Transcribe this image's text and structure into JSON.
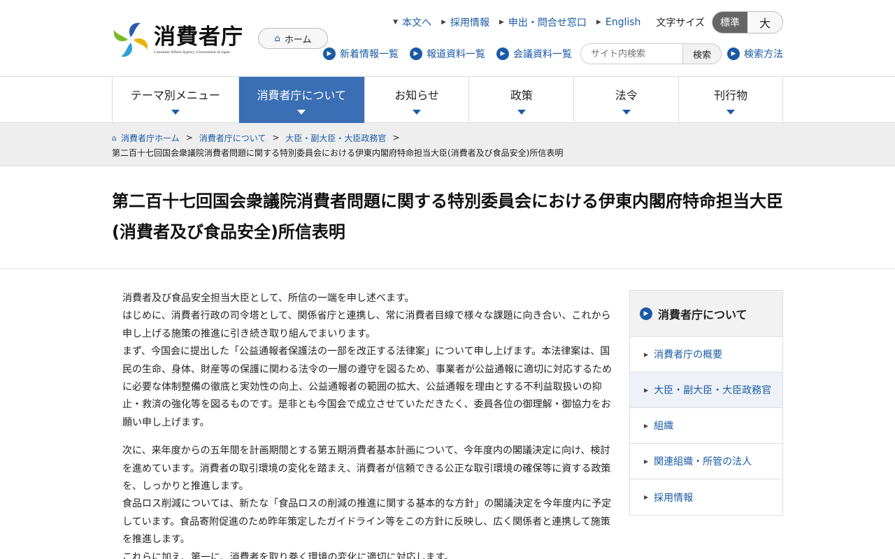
{
  "logo": {
    "title": "消費者庁",
    "subtitle": "Consumer Affairs Agency, Government of Japan"
  },
  "home_button": "ホーム",
  "top_links": [
    "本文へ",
    "採用情報",
    "申出・問合せ窓口",
    "English"
  ],
  "font_size": {
    "label": "文字サイズ",
    "standard": "標準",
    "large": "大"
  },
  "sub_links": [
    "新着情報一覧",
    "報道資料一覧",
    "会議資料一覧"
  ],
  "search": {
    "placeholder": "サイト内検索",
    "button": "検索",
    "howto": "検索方法"
  },
  "nav": [
    "テーマ別メニュー",
    "消費者庁について",
    "お知らせ",
    "政策",
    "法令",
    "刊行物"
  ],
  "breadcrumb": {
    "items": [
      "消費者庁ホーム",
      "消費者庁について",
      "大臣・副大臣・大臣政務官"
    ],
    "current": "第二百十七回国会衆議院消費者問題に関する特別委員会における伊東内閣府特命担当大臣(消費者及び食品安全)所信表明"
  },
  "page_title": "第二百十七回国会衆議院消費者問題に関する特別委員会における伊東内閣府特命担当大臣(消費者及び食品安全)所信表明",
  "article": {
    "p1": "消費者及び食品安全担当大臣として、所信の一端を申し述べます。",
    "p2": "はじめに、消費者行政の司令塔として、関係省庁と連携し、常に消費者目線で様々な課題に向き合い、これから申し上げる施策の推進に引き続き取り組んでまいります。",
    "p3": "まず、今国会に提出した「公益通報者保護法の一部を改正する法律案」について申し上げます。本法律案は、国民の生命、身体、財産等の保護に関わる法令の一層の遵守を図るため、事業者が公益通報に適切に対応するために必要な体制整備の徹底と実効性の向上、公益通報者の範囲の拡大、公益通報を理由とする不利益取扱いの抑止・救済の強化等を図るものです。是非とも今国会で成立させていただきたく、委員各位の御理解・御協力をお願い申し上げます。",
    "p4": "次に、来年度からの五年間を計画期間とする第五期消費者基本計画について、今年度内の閣議決定に向け、検討を進めています。消費者の取引環境の変化を踏まえ、消費者が信頼できる公正な取引環境の確保等に資する政策を、しっかりと推進します。",
    "p5": "食品ロス削減については、新たな「食品ロスの削減の推進に関する基本的な方針」の閣議決定を今年度内に予定しています。食品寄附促進のため昨年策定したガイドライン等をこの方針に反映し、広く関係者と連携して施策を推進します。",
    "p6": "これらに加え、第一に、消費者を取り巻く環境の変化に適切に対応します。"
  },
  "sidebar": {
    "title": "消費者庁について",
    "items": [
      "消費者庁の概要",
      "大臣・副大臣・大臣政務官",
      "組織",
      "関連組織・所管の法人",
      "採用情報"
    ]
  }
}
